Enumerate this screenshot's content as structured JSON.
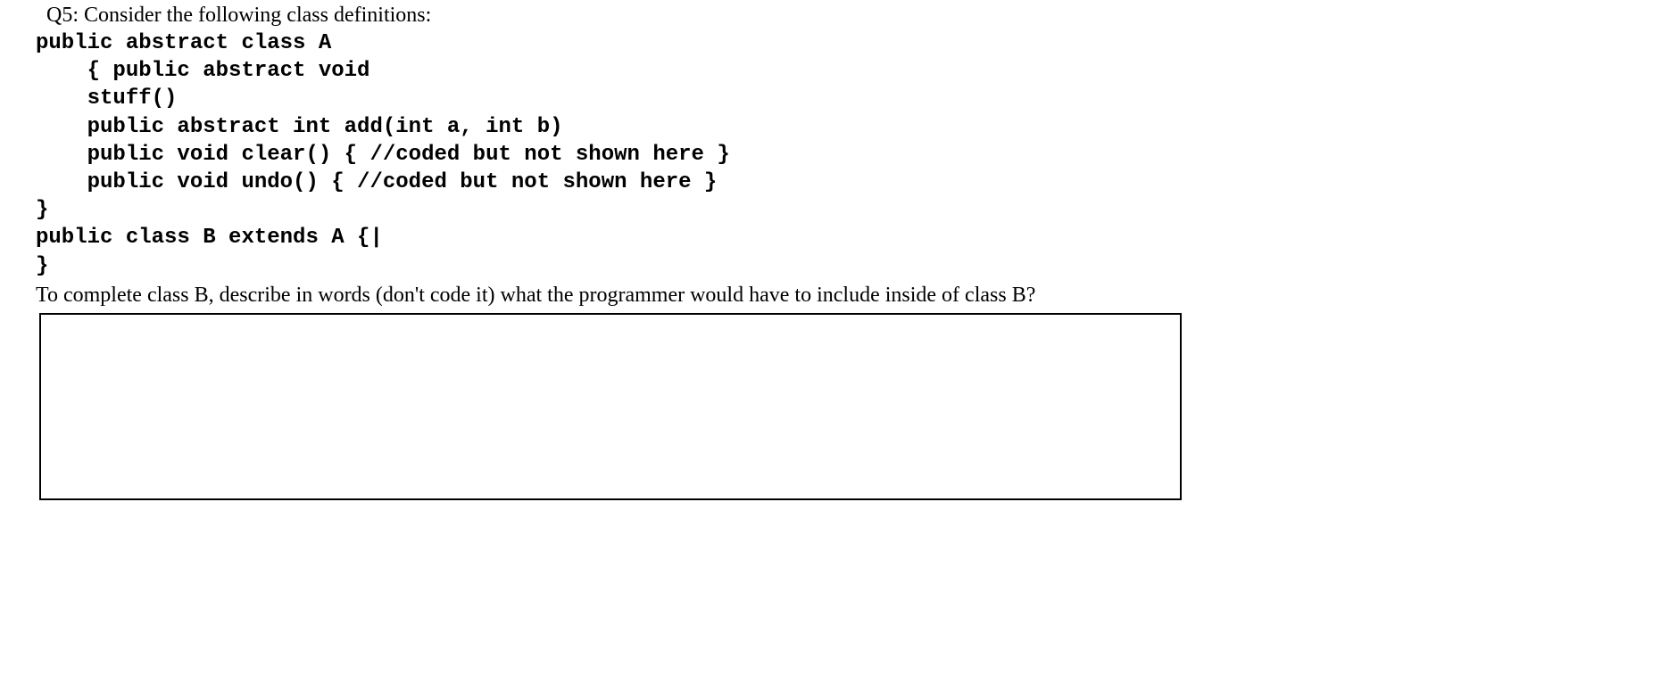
{
  "question": {
    "intro": "Q5: Consider the following class definitions:",
    "code": "public abstract class A\n    { public abstract void\n    stuff()\n    public abstract int add(int a, int b)\n    public void clear() { //coded but not shown here }\n    public void undo() { //coded but not shown here }\n}\npublic class B extends A {|\n}",
    "prompt": "To complete class B, describe in words (don't code it) what the programmer would have to include inside of class B?"
  }
}
